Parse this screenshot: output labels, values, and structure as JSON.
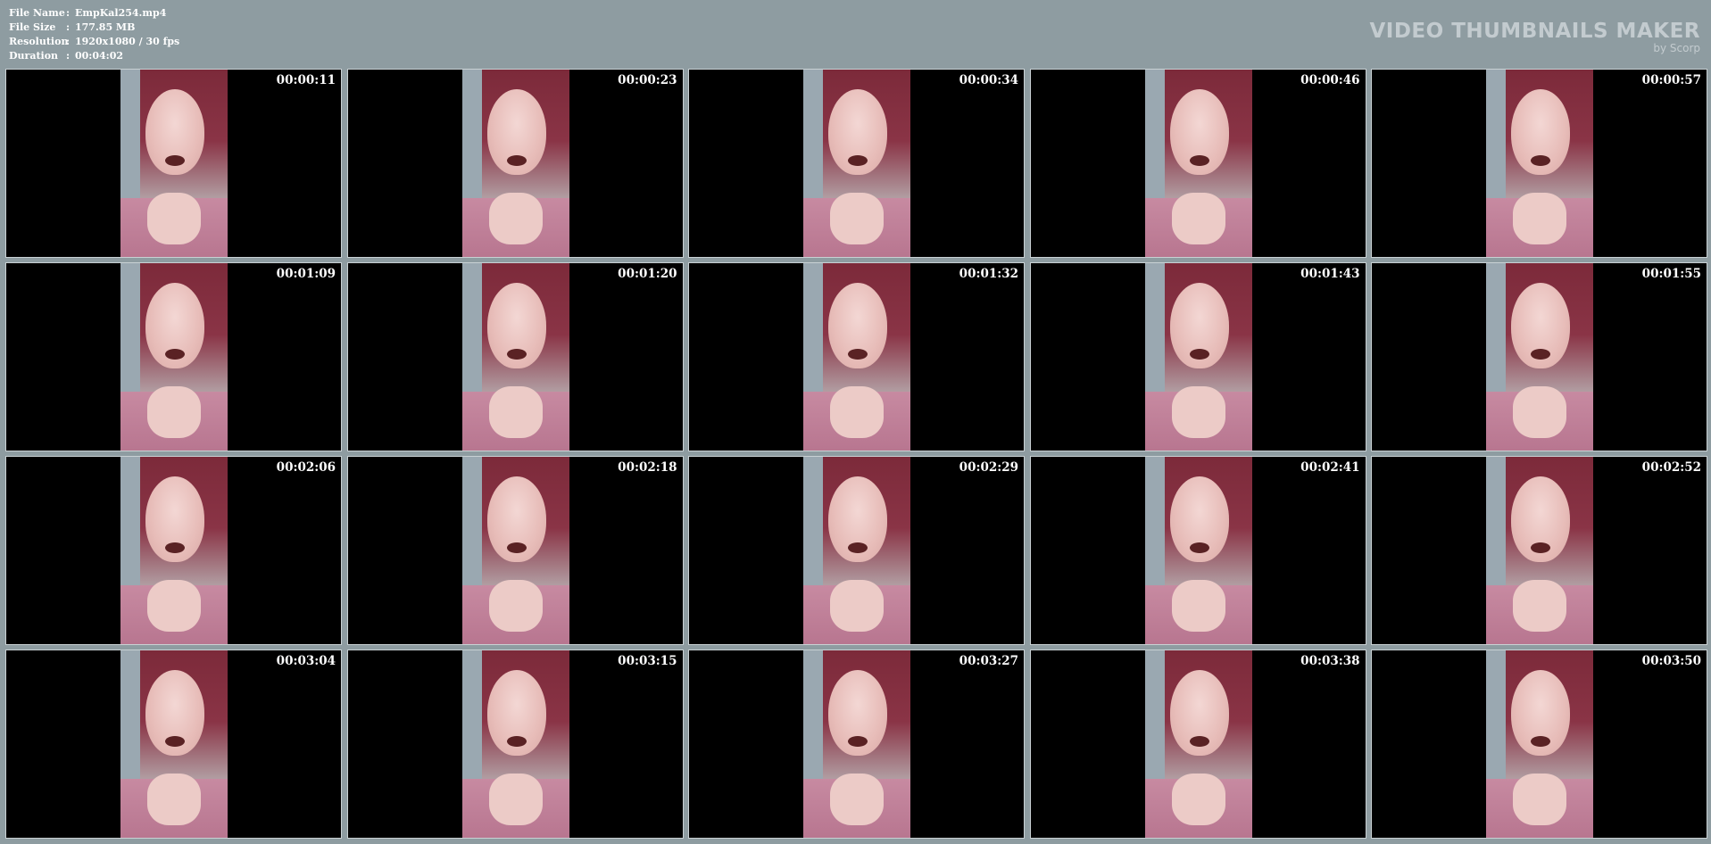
{
  "info": {
    "rows": [
      {
        "label": "File Name",
        "value": "EmpKal254.mp4"
      },
      {
        "label": "File Size",
        "value": "177.85 MB"
      },
      {
        "label": "Resolution",
        "value": "1920x1080 / 30 fps"
      },
      {
        "label": "Duration",
        "value": "00:04:02"
      }
    ],
    "separator": ":"
  },
  "brand": {
    "title": "VIDEO THUMBNAILS MAKER",
    "subtitle": "by Scorp"
  },
  "thumbnails": [
    {
      "time": "00:00:11"
    },
    {
      "time": "00:00:23"
    },
    {
      "time": "00:00:34"
    },
    {
      "time": "00:00:46"
    },
    {
      "time": "00:00:57"
    },
    {
      "time": "00:01:09"
    },
    {
      "time": "00:01:20"
    },
    {
      "time": "00:01:32"
    },
    {
      "time": "00:01:43"
    },
    {
      "time": "00:01:55"
    },
    {
      "time": "00:02:06"
    },
    {
      "time": "00:02:18"
    },
    {
      "time": "00:02:29"
    },
    {
      "time": "00:02:41"
    },
    {
      "time": "00:02:52"
    },
    {
      "time": "00:03:04"
    },
    {
      "time": "00:03:15"
    },
    {
      "time": "00:03:27"
    },
    {
      "time": "00:03:38"
    },
    {
      "time": "00:03:50"
    }
  ]
}
